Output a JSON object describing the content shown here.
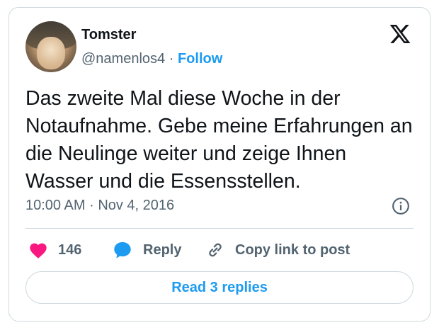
{
  "author": {
    "name": "Tomster",
    "handle": "@namenlos4",
    "separator": "·",
    "follow_label": "Follow"
  },
  "tweet": {
    "text": "Das zweite Mal diese Woche in der Notaufnahme. Gebe meine Erfahrungen an die Neulinge weiter und zeige Ihnen Wasser und die Essensstellen.",
    "time": "10:00 AM",
    "separator": "·",
    "date": "Nov 4, 2016"
  },
  "actions": {
    "likes_count": "146",
    "reply_label": "Reply",
    "copy_label": "Copy link to post"
  },
  "read_replies_label": "Read 3 replies",
  "icons": {
    "logo": "x-logo-icon",
    "info": "info-icon",
    "like": "heart-icon",
    "reply": "speech-bubble-icon",
    "copy": "link-icon"
  },
  "colors": {
    "accent": "#1d9bf0",
    "like": "#f91880",
    "text": "#0f1419",
    "secondary": "#536471",
    "border": "#cfd9de"
  }
}
